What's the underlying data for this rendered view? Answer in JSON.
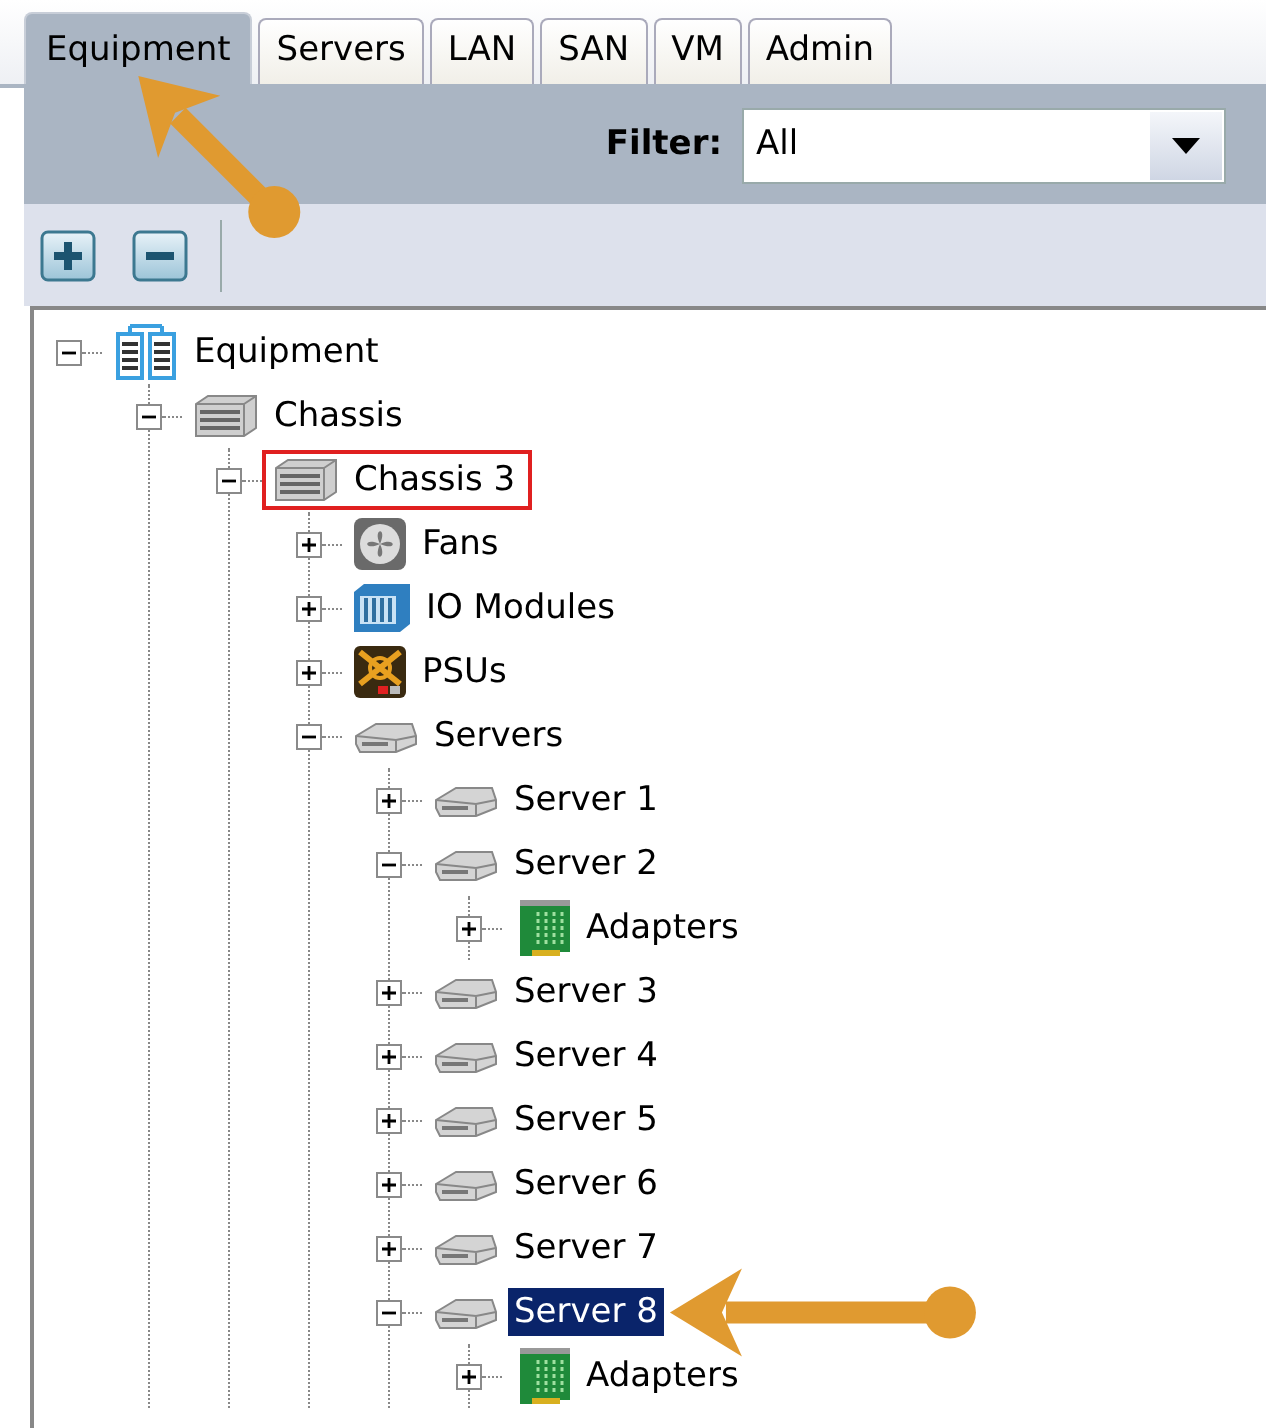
{
  "tabs": [
    {
      "label": "Equipment",
      "selected": true,
      "pointed": true
    },
    {
      "label": "Servers",
      "selected": false,
      "pointed": false
    },
    {
      "label": "LAN",
      "selected": false,
      "pointed": false
    },
    {
      "label": "SAN",
      "selected": false,
      "pointed": false
    },
    {
      "label": "VM",
      "selected": false,
      "pointed": false
    },
    {
      "label": "Admin",
      "selected": false,
      "pointed": false
    }
  ],
  "filter": {
    "label": "Filter:",
    "value": "All"
  },
  "toolbar": {
    "buttons": [
      {
        "kind": "expand"
      },
      {
        "kind": "collapse"
      }
    ]
  },
  "tree": [
    {
      "label": "Equipment",
      "kind": "equipment",
      "expanded": true,
      "selected": false,
      "highlighted": false,
      "pointed": false,
      "children": [
        {
          "label": "Chassis",
          "kind": "chassis",
          "expanded": true,
          "selected": false,
          "highlighted": false,
          "pointed": false,
          "children": [
            {
              "label": "Chassis 3",
              "kind": "chassis",
              "expanded": true,
              "selected": false,
              "highlighted": true,
              "pointed": false,
              "children": [
                {
                  "label": "Fans",
                  "kind": "fan",
                  "expanded": false,
                  "selected": false,
                  "highlighted": false,
                  "pointed": false
                },
                {
                  "label": "IO Modules",
                  "kind": "io",
                  "expanded": false,
                  "selected": false,
                  "highlighted": false,
                  "pointed": false
                },
                {
                  "label": "PSUs",
                  "kind": "psu",
                  "expanded": false,
                  "selected": false,
                  "highlighted": false,
                  "pointed": false
                },
                {
                  "label": "Servers",
                  "kind": "server",
                  "expanded": true,
                  "selected": false,
                  "highlighted": false,
                  "pointed": false,
                  "children": [
                    {
                      "label": "Server 1",
                      "kind": "server",
                      "expanded": false,
                      "selected": false,
                      "highlighted": false,
                      "pointed": false
                    },
                    {
                      "label": "Server 2",
                      "kind": "server",
                      "expanded": true,
                      "selected": false,
                      "highlighted": false,
                      "pointed": false,
                      "children": [
                        {
                          "label": "Adapters",
                          "kind": "adapter",
                          "expanded": false,
                          "selected": false,
                          "highlighted": false,
                          "pointed": false
                        }
                      ]
                    },
                    {
                      "label": "Server 3",
                      "kind": "server",
                      "expanded": false,
                      "selected": false,
                      "highlighted": false,
                      "pointed": false
                    },
                    {
                      "label": "Server 4",
                      "kind": "server",
                      "expanded": false,
                      "selected": false,
                      "highlighted": false,
                      "pointed": false
                    },
                    {
                      "label": "Server 5",
                      "kind": "server",
                      "expanded": false,
                      "selected": false,
                      "highlighted": false,
                      "pointed": false
                    },
                    {
                      "label": "Server 6",
                      "kind": "server",
                      "expanded": false,
                      "selected": false,
                      "highlighted": false,
                      "pointed": false
                    },
                    {
                      "label": "Server 7",
                      "kind": "server",
                      "expanded": false,
                      "selected": false,
                      "highlighted": false,
                      "pointed": false
                    },
                    {
                      "label": "Server 8",
                      "kind": "server",
                      "expanded": true,
                      "selected": true,
                      "highlighted": false,
                      "pointed": true,
                      "children": [
                        {
                          "label": "Adapters",
                          "kind": "adapter",
                          "expanded": false,
                          "selected": false,
                          "highlighted": false,
                          "pointed": false
                        }
                      ]
                    }
                  ]
                }
              ]
            }
          ]
        }
      ]
    }
  ]
}
